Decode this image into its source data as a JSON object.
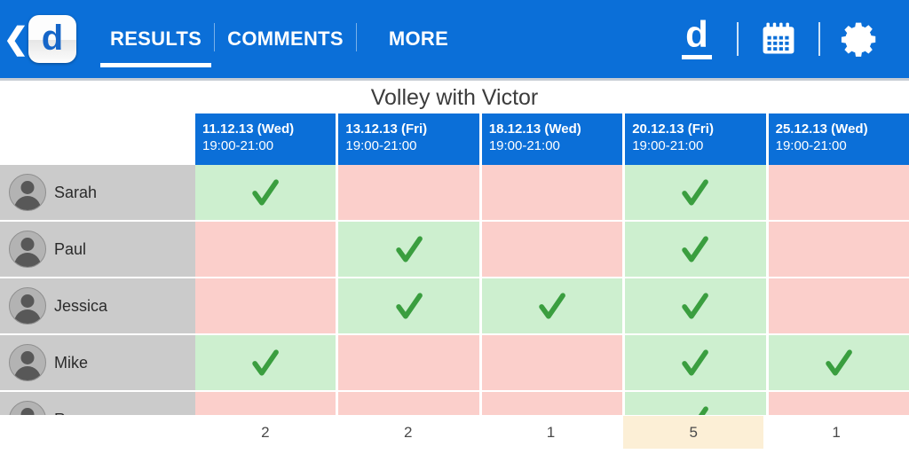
{
  "appbar": {
    "back_icon": "back-chevron-icon",
    "logo_letter": "d",
    "tabs": [
      {
        "label": "RESULTS",
        "active": true
      },
      {
        "label": "COMMENTS",
        "active": false
      },
      {
        "label": "MORE",
        "active": false
      }
    ],
    "actions": [
      {
        "name": "doodle-logo-icon",
        "glyph": "d"
      },
      {
        "name": "calendar-icon",
        "glyph": "calendar"
      },
      {
        "name": "settings-gear-icon",
        "glyph": "gear"
      }
    ],
    "background_color": "#0B6FD8"
  },
  "poll": {
    "title": "Volley with Victor",
    "columns": [
      {
        "date": "11.12.13 (Wed)",
        "time": "19:00-21:00",
        "total": "2",
        "best": false
      },
      {
        "date": "13.12.13 (Fri)",
        "time": "19:00-21:00",
        "total": "2",
        "best": false
      },
      {
        "date": "18.12.13 (Wed)",
        "time": "19:00-21:00",
        "total": "1",
        "best": false
      },
      {
        "date": "20.12.13 (Fri)",
        "time": "19:00-21:00",
        "total": "5",
        "best": true
      },
      {
        "date": "25.12.13 (Wed)",
        "time": "19:00-21:00",
        "total": "1",
        "best": false
      }
    ],
    "participants": [
      {
        "name": "Sarah",
        "votes": [
          true,
          false,
          false,
          true,
          false
        ]
      },
      {
        "name": "Paul",
        "votes": [
          false,
          true,
          false,
          true,
          false
        ]
      },
      {
        "name": "Jessica",
        "votes": [
          false,
          true,
          true,
          true,
          false
        ]
      },
      {
        "name": "Mike",
        "votes": [
          true,
          false,
          false,
          true,
          true
        ]
      },
      {
        "name": "Roger",
        "votes": [
          false,
          false,
          false,
          true,
          false
        ]
      }
    ],
    "colors": {
      "yes": "#cdefcf",
      "no": "#fbcfcb",
      "check": "#3a9e3f",
      "header": "#0B6FD8",
      "name_row": "#cbcbcb",
      "best_total": "#fcefd6"
    }
  }
}
